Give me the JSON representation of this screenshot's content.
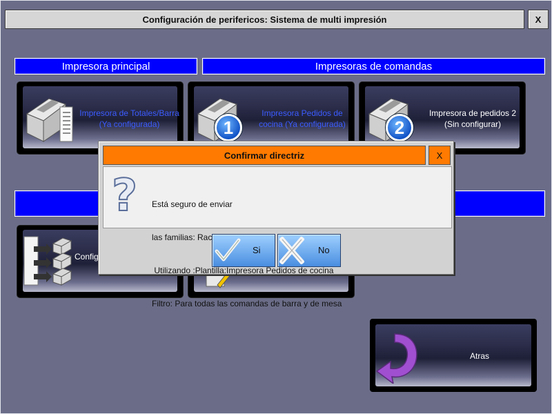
{
  "window": {
    "title": "Configuración de perifericos: Sistema de multi impresión",
    "close_label": "X"
  },
  "sections": {
    "principal": "Impresora principal",
    "comandas": "Impresoras de comandas"
  },
  "tiles": [
    {
      "line1": "Impresora de Totales/Barra",
      "line2": "(Ya configurada)",
      "color": "#3b5bff"
    },
    {
      "line1": "Impresora Pedidos de",
      "line2": "cocina (Ya configurada)",
      "badge": "1",
      "color": "#3b5bff"
    },
    {
      "line1": "Impresora de pedidos 2",
      "line2": "(Sin configurar)",
      "badge": "2",
      "color": "#ffffff"
    },
    {
      "line1": "Config",
      "color": "#ffffff"
    }
  ],
  "dialog": {
    "title": "Confirmar directriz",
    "close_label": "X",
    "message": [
      "Está seguro de enviar",
      "las familias: Raciones",
      " Utilizando :Plantilla:Impresora Pedidos de cocina",
      "Filtro: Para todas las comandas de barra y de mesa"
    ],
    "yes_label": "Si",
    "no_label": "No"
  },
  "back_button": {
    "label": "Atras"
  },
  "colors": {
    "background": "#6b6d88",
    "section_blue": "#0000ff",
    "dialog_title": "#ff7a00",
    "button_blue": "#4a8ee0"
  }
}
